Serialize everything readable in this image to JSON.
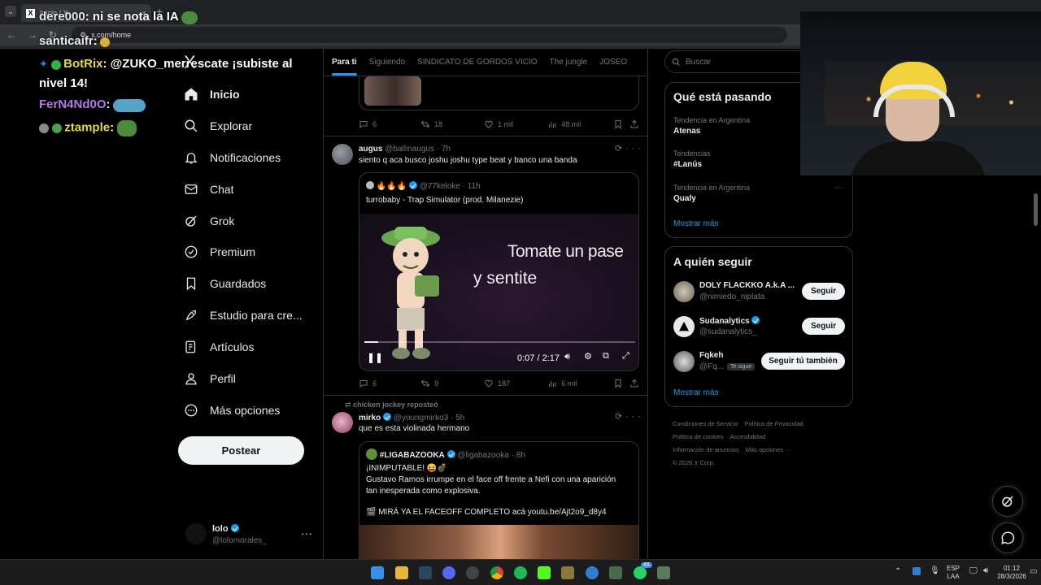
{
  "browser": {
    "tab_title": "Inicio / X",
    "tab_close": "×",
    "new_tab": "+",
    "url": "x.com/home"
  },
  "chat_overlay": [
    {
      "user": "dere000",
      "text": ": ni se nota la IA"
    },
    {
      "user": "santicaifr",
      "text": ":"
    },
    {
      "user": "BotRix",
      "text": ": @ZUKO_merrescate ¡subiste al"
    },
    {
      "user": "",
      "text": "nivel 14!"
    },
    {
      "user": "FerN4Nd0O",
      "text": ":"
    },
    {
      "user": "ztample",
      "text": ":"
    }
  ],
  "nav": {
    "logo": "X",
    "items": [
      {
        "label": "Inicio",
        "icon": "home-icon"
      },
      {
        "label": "Explorar",
        "icon": "search-icon"
      },
      {
        "label": "Notificaciones",
        "icon": "bell-icon"
      },
      {
        "label": "Chat",
        "icon": "mail-icon"
      },
      {
        "label": "Grok",
        "icon": "grok-icon"
      },
      {
        "label": "Premium",
        "icon": "premium-icon"
      },
      {
        "label": "Guardados",
        "icon": "bookmark-icon"
      },
      {
        "label": "Estudio para cre...",
        "icon": "rocket-icon"
      },
      {
        "label": "Artículos",
        "icon": "articles-icon"
      },
      {
        "label": "Perfil",
        "icon": "person-icon"
      },
      {
        "label": "Más opciones",
        "icon": "more-circle-icon"
      }
    ],
    "post_button": "Postear",
    "account": {
      "name": "lolo",
      "handle": "@lolomorales_",
      "more": "···"
    }
  },
  "tabs": [
    "Para ti",
    "Siguiendo",
    "SINDICATO DE GORDOS VICIO",
    "The jungle",
    "JOSEO"
  ],
  "feed": {
    "tweet0_actions": {
      "replies": "6",
      "reposts": "18",
      "likes": "1 mil",
      "views": "48 mil"
    },
    "tweet1": {
      "name": "augus",
      "handle": "@ballinaugus",
      "time": "· 7h",
      "text": "siento q aca busco joshu joshu type beat y banco una banda",
      "quote": {
        "name": "🔥🔥🔥",
        "handle": "@77keloke",
        "time": "· 11h",
        "text": "turrobaby - Trap Simulator (prod. Milanezie)",
        "video_line1": "Tomate un pase",
        "video_line2": "y sentite",
        "video_time": "0:07 / 2:17",
        "progress": 0.05
      },
      "actions": {
        "replies": "6",
        "reposts": "9",
        "likes": "187",
        "views": "6 mil"
      }
    },
    "tweet2": {
      "reposted_by": "chicken jockey reposteó",
      "name": "mirko",
      "handle": "@youngmirko3",
      "time": "· 5h",
      "text": "que es esta violinada hermano",
      "quote": {
        "name": "#LIGABAZOOKA",
        "handle": "@ligabazooka",
        "time": "· 8h",
        "line1": "¡INIMPUTABLE! 😝💣",
        "line2": "Gustavo Ramos irrumpe en el face off frente a Nefi con una aparición",
        "line3": "tan inesperada como explosiva.",
        "line4": "🎬 MIRÁ YA EL FACEOFF COMPLETO acá youtu.be/Ajt2o9_d8y4"
      }
    }
  },
  "right": {
    "search_placeholder": "Buscar",
    "trends_title": "Qué está pasando",
    "trends": [
      {
        "meta": "Tendencia en Argentina",
        "name": "Atenas"
      },
      {
        "meta": "Tendencias",
        "name": "#Lanús"
      },
      {
        "meta": "Tendencia en Argentina",
        "name": "Qualy"
      }
    ],
    "trend_more": "···",
    "show_more": "Mostrar más",
    "follow_title": "A quién seguir",
    "follow": [
      {
        "name": "DOLY FLACKKO A.k.A ...",
        "handle": "@nimiedo_niplata",
        "button": "Seguir",
        "te_sigue": ""
      },
      {
        "name": "Sudanalytics",
        "handle": "@sudanalytics_",
        "button": "Seguir",
        "te_sigue": ""
      },
      {
        "name": "Fqkeh",
        "handle": "@Fq...",
        "button": "Seguir tú también",
        "te_sigue": "Te sigue"
      }
    ],
    "footer": [
      "Condiciones de Servicio",
      "Política de Privacidad",
      "Política de cookies",
      "Accesibilidad",
      "Información de anuncios",
      "Más opciones ···",
      "© 2026 X Corp."
    ]
  },
  "taskbar": {
    "lang": "ESP",
    "layout": "LAA",
    "time": "01:12",
    "date": "28/3/2026",
    "badge": "46"
  },
  "colors": {
    "accent": "#1d9bf0",
    "bg": "#000000",
    "border": "#2f3336",
    "muted": "#71767b"
  }
}
